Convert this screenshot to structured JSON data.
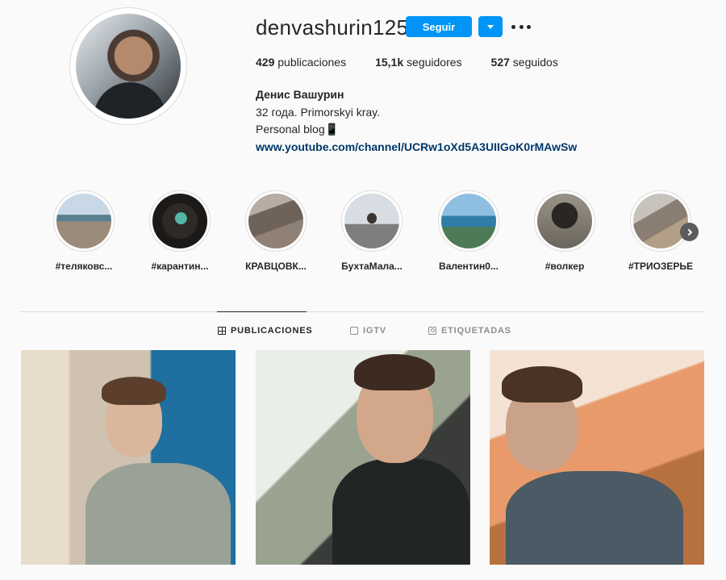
{
  "profile": {
    "username": "denvashurin125",
    "follow_label": "Seguir",
    "stats": {
      "posts_count": "429",
      "posts_label": " publicaciones",
      "followers_count": "15,1k",
      "followers_label": " seguidores",
      "following_count": "527",
      "following_label": " seguidos"
    },
    "bio": {
      "name": "Денис Вашурин",
      "line1": "32 года. Primorskyi kray.",
      "line2": "Personal blog📱",
      "link": "www.youtube.com/channel/UCRw1oXd5A3UIIGoK0rMAwSw"
    }
  },
  "highlights": [
    {
      "label": "#теляковс..."
    },
    {
      "label": "#карантин..."
    },
    {
      "label": "КРАВЦОВК..."
    },
    {
      "label": "БухтаМала..."
    },
    {
      "label": "Валентин0..."
    },
    {
      "label": "#волкер"
    },
    {
      "label": "#ТРИОЗЕРЬЕ"
    }
  ],
  "tabs": [
    {
      "label": "PUBLICACIONES",
      "icon": "grid-icon",
      "active": true
    },
    {
      "label": "IGTV",
      "icon": "tv-icon",
      "active": false
    },
    {
      "label": "ETIQUETADAS",
      "icon": "tag-icon",
      "active": false
    }
  ],
  "colors": {
    "accent": "#0095f6",
    "link": "#00376b",
    "background": "#fafafa"
  }
}
